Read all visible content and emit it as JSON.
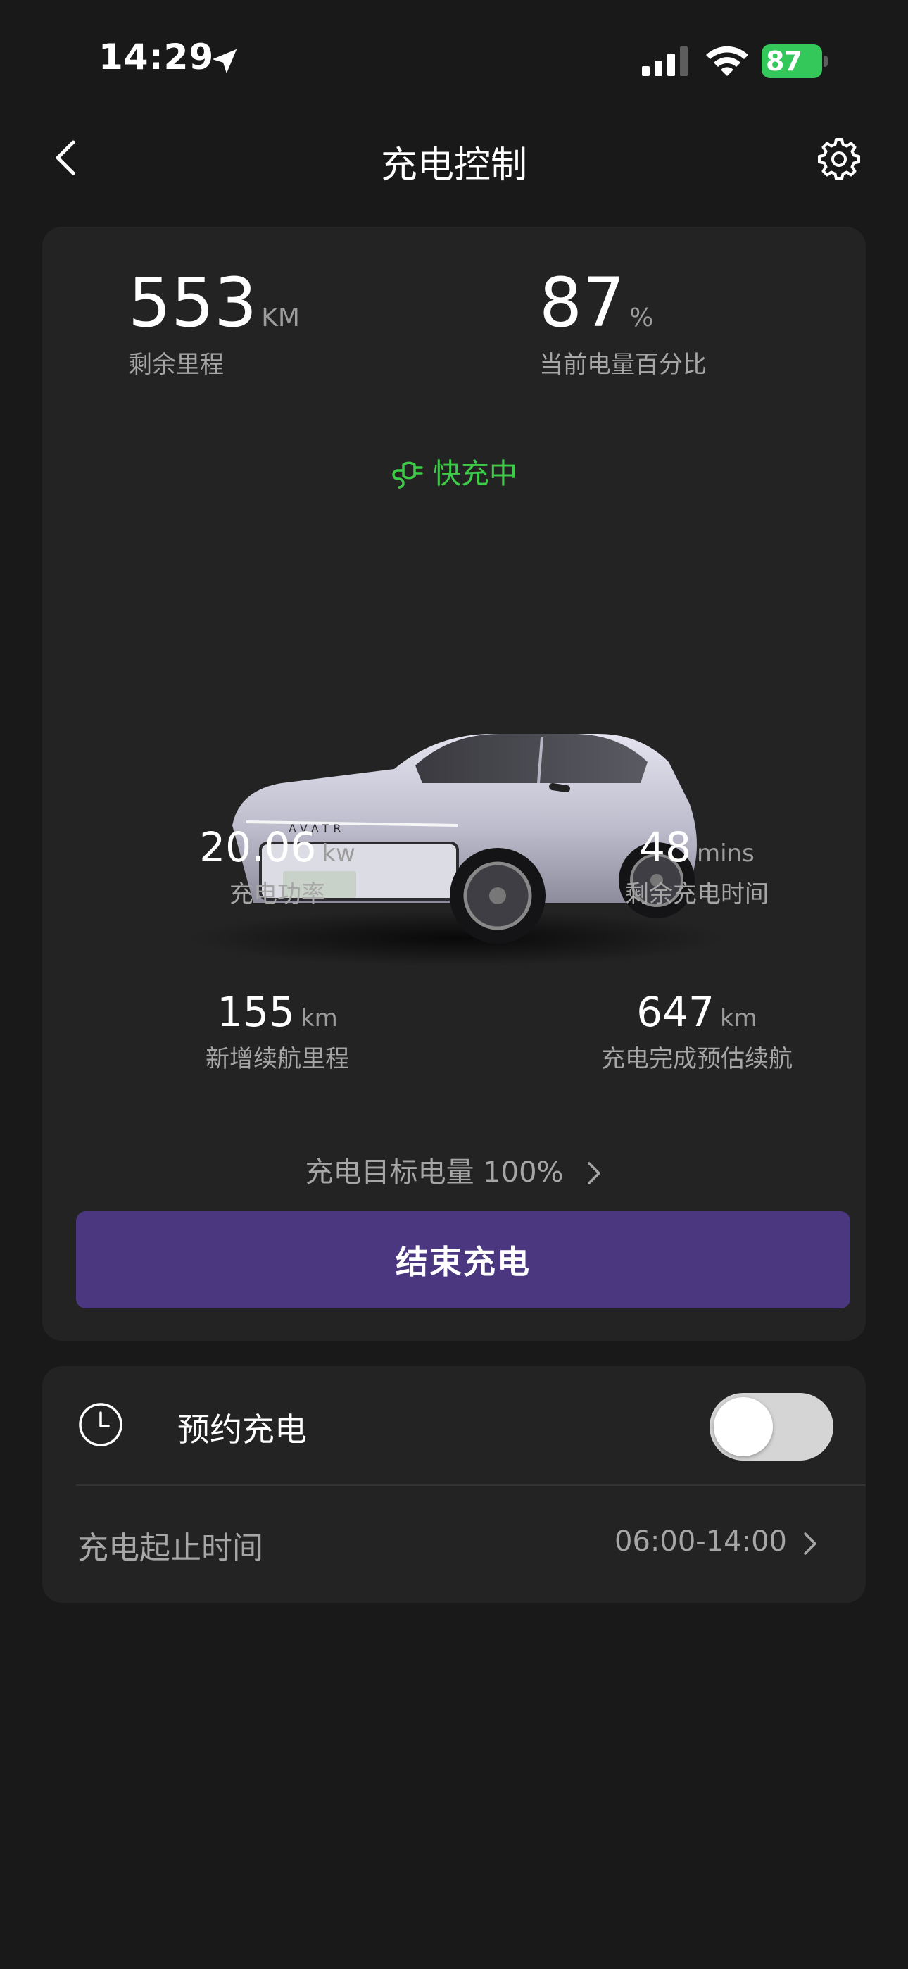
{
  "status_bar": {
    "time": "14:29",
    "battery_level": "87",
    "icons": [
      "location-arrow-icon",
      "signal-icon",
      "wifi-icon",
      "battery-charging-icon"
    ]
  },
  "nav": {
    "title": "充电控制",
    "back_icon": "chevron-left-icon",
    "settings_icon": "gear-icon"
  },
  "summary": {
    "range_value": "553",
    "range_unit": "KM",
    "range_label": "剩余里程",
    "battery_value": "87",
    "battery_unit": "%",
    "battery_label": "当前电量百分比"
  },
  "charging_status": {
    "label": "快充中",
    "icon": "plug-icon",
    "color": "#3dcb48"
  },
  "metrics": {
    "power_value": "20.06",
    "power_unit": "kw",
    "power_label": "充电功率",
    "remaining_time_value": "48",
    "remaining_time_unit": "mins",
    "remaining_time_label": "剩余充电时间",
    "added_range_value": "155",
    "added_range_unit": "km",
    "added_range_label": "新增续航里程",
    "estimated_range_value": "647",
    "estimated_range_unit": "km",
    "estimated_range_label": "充电完成预估续航"
  },
  "target": {
    "label": "充电目标电量 100%"
  },
  "actions": {
    "end_charging": "结束充电",
    "button_color": "#4a377f"
  },
  "schedule": {
    "label": "预约充电",
    "icon": "clock-icon",
    "toggle_on": false,
    "time_label": "充电起止时间",
    "time_value": "06:00-14:00"
  }
}
